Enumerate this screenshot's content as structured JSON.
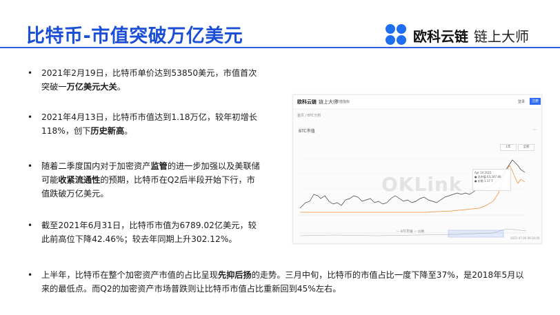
{
  "header": {
    "title": "比特币-市值突破万亿美元",
    "logo_brand": "欧科云链",
    "logo_sub": "链上大师"
  },
  "bullets": [
    {
      "pre": "2021年2月19日，比特币单价达到53850美元，市值首次突破一",
      "bold": "万亿美元大关",
      "post": "。"
    },
    {
      "pre": "2021年4月13日，比特币市值达到1.18万亿，较年初增长118%，创下",
      "bold": "历史新高",
      "post": "。"
    },
    {
      "pre": "随着二季度国内对于加密资产",
      "bold1": "监管",
      "mid1": "的进一步加强以及美联储可能",
      "bold2": "收紧流通性",
      "post": "的预期，比特币在Q2后半段开始下行，市值跌破万亿美元。"
    },
    {
      "text": "截至2021年6月31日，比特币市值为6789.02亿美元，较此前高位下降42.46%；较去年同期上升302.12%。"
    }
  ],
  "wide_bullet": {
    "pre": "上半年，比特币在整个加密资产市值的占比呈现",
    "bold": "先抑后扬",
    "post": "的走势。三月中旬，比特币的市值占比一度下降至37%，是2018年5月以来的最低点。而Q2的加密资产市场普跌则让比特币市值占比重新回到45%左右。"
  },
  "bullet_char": "•",
  "screenshot": {
    "brand": "欧科云链",
    "brand_sub": "链上大师",
    "nav": "市值指标",
    "login": "登录",
    "signup": "注册",
    "crumb": "首页 / BTC分析",
    "series_title": "BTC市值",
    "watermark": "OKLink",
    "tooltip": {
      "date": "Apr 14 2021",
      "l1": "● 总市值",
      "v1": "63,347.80",
      "l2": "● 价格",
      "v2": "1.17 T"
    },
    "legend": "— BTC市值    — 价格",
    "footer": "2021-07-06 09:30:00",
    "ranges": [
      "1年",
      "全部"
    ]
  }
}
